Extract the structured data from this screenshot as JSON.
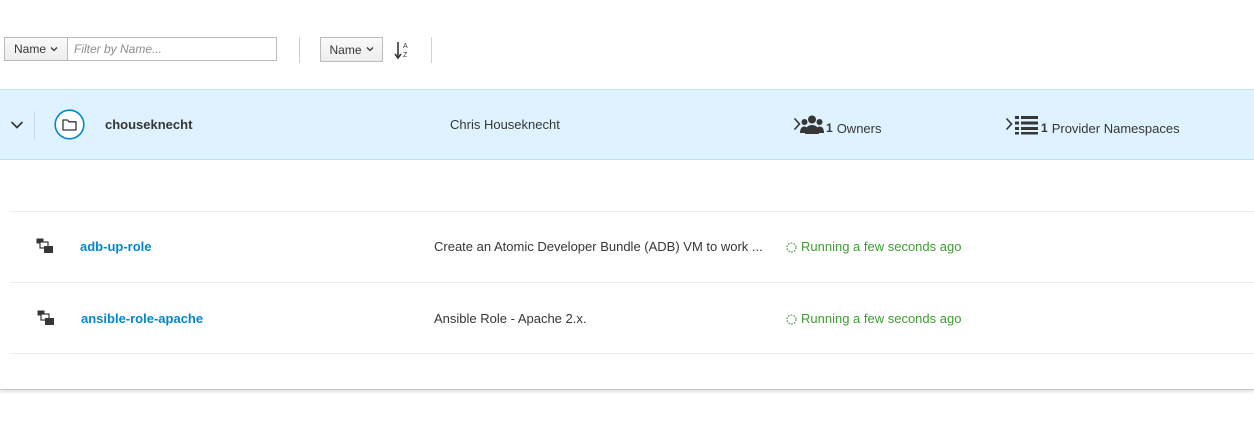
{
  "toolbar": {
    "filter_field": "Name",
    "filter_placeholder": "Filter by Name...",
    "sort_field": "Name",
    "sort_icon": "sort-alpha-asc-icon"
  },
  "namespace": {
    "name": "chouseknecht",
    "display_name": "Chris Houseknecht",
    "owners_count": "1",
    "owners_label": "Owners",
    "providers_count": "1",
    "providers_label": "Provider Namespaces"
  },
  "repositories": [
    {
      "name": "adb-up-role",
      "description": "Create an Atomic Developer Bundle (ADB) VM to work ...",
      "status": "Running a few seconds ago"
    },
    {
      "name": "ansible-role-apache",
      "description": "Ansible Role - Apache 2.x.",
      "status": "Running a few seconds ago"
    }
  ],
  "colors": {
    "link": "#0088ce",
    "status": "#3f9c35",
    "selected_row": "#def3ff"
  }
}
